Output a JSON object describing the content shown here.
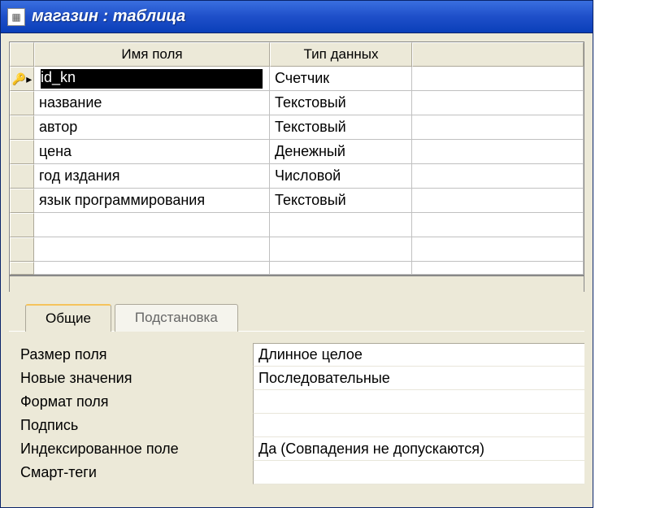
{
  "window": {
    "title": "магазин : таблица"
  },
  "grid": {
    "headers": {
      "field_name": "Имя поля",
      "data_type": "Тип данных"
    },
    "rows": [
      {
        "field": "id_kn",
        "type": "Счетчик",
        "pk": true,
        "selected": true
      },
      {
        "field": "название",
        "type": "Текстовый"
      },
      {
        "field": "автор",
        "type": "Текстовый"
      },
      {
        "field": "цена",
        "type": "Денежный"
      },
      {
        "field": "год издания",
        "type": "Числовой"
      },
      {
        "field": "язык программирования",
        "type": "Текстовый"
      }
    ]
  },
  "tabs": {
    "general": "Общие",
    "lookup": "Подстановка"
  },
  "props": [
    {
      "label": "Размер поля",
      "value": "Длинное целое"
    },
    {
      "label": "Новые значения",
      "value": "Последовательные"
    },
    {
      "label": "Формат поля",
      "value": ""
    },
    {
      "label": "Подпись",
      "value": ""
    },
    {
      "label": "Индексированное поле",
      "value": "Да (Совпадения не допускаются)"
    },
    {
      "label": "Смарт-теги",
      "value": ""
    }
  ]
}
